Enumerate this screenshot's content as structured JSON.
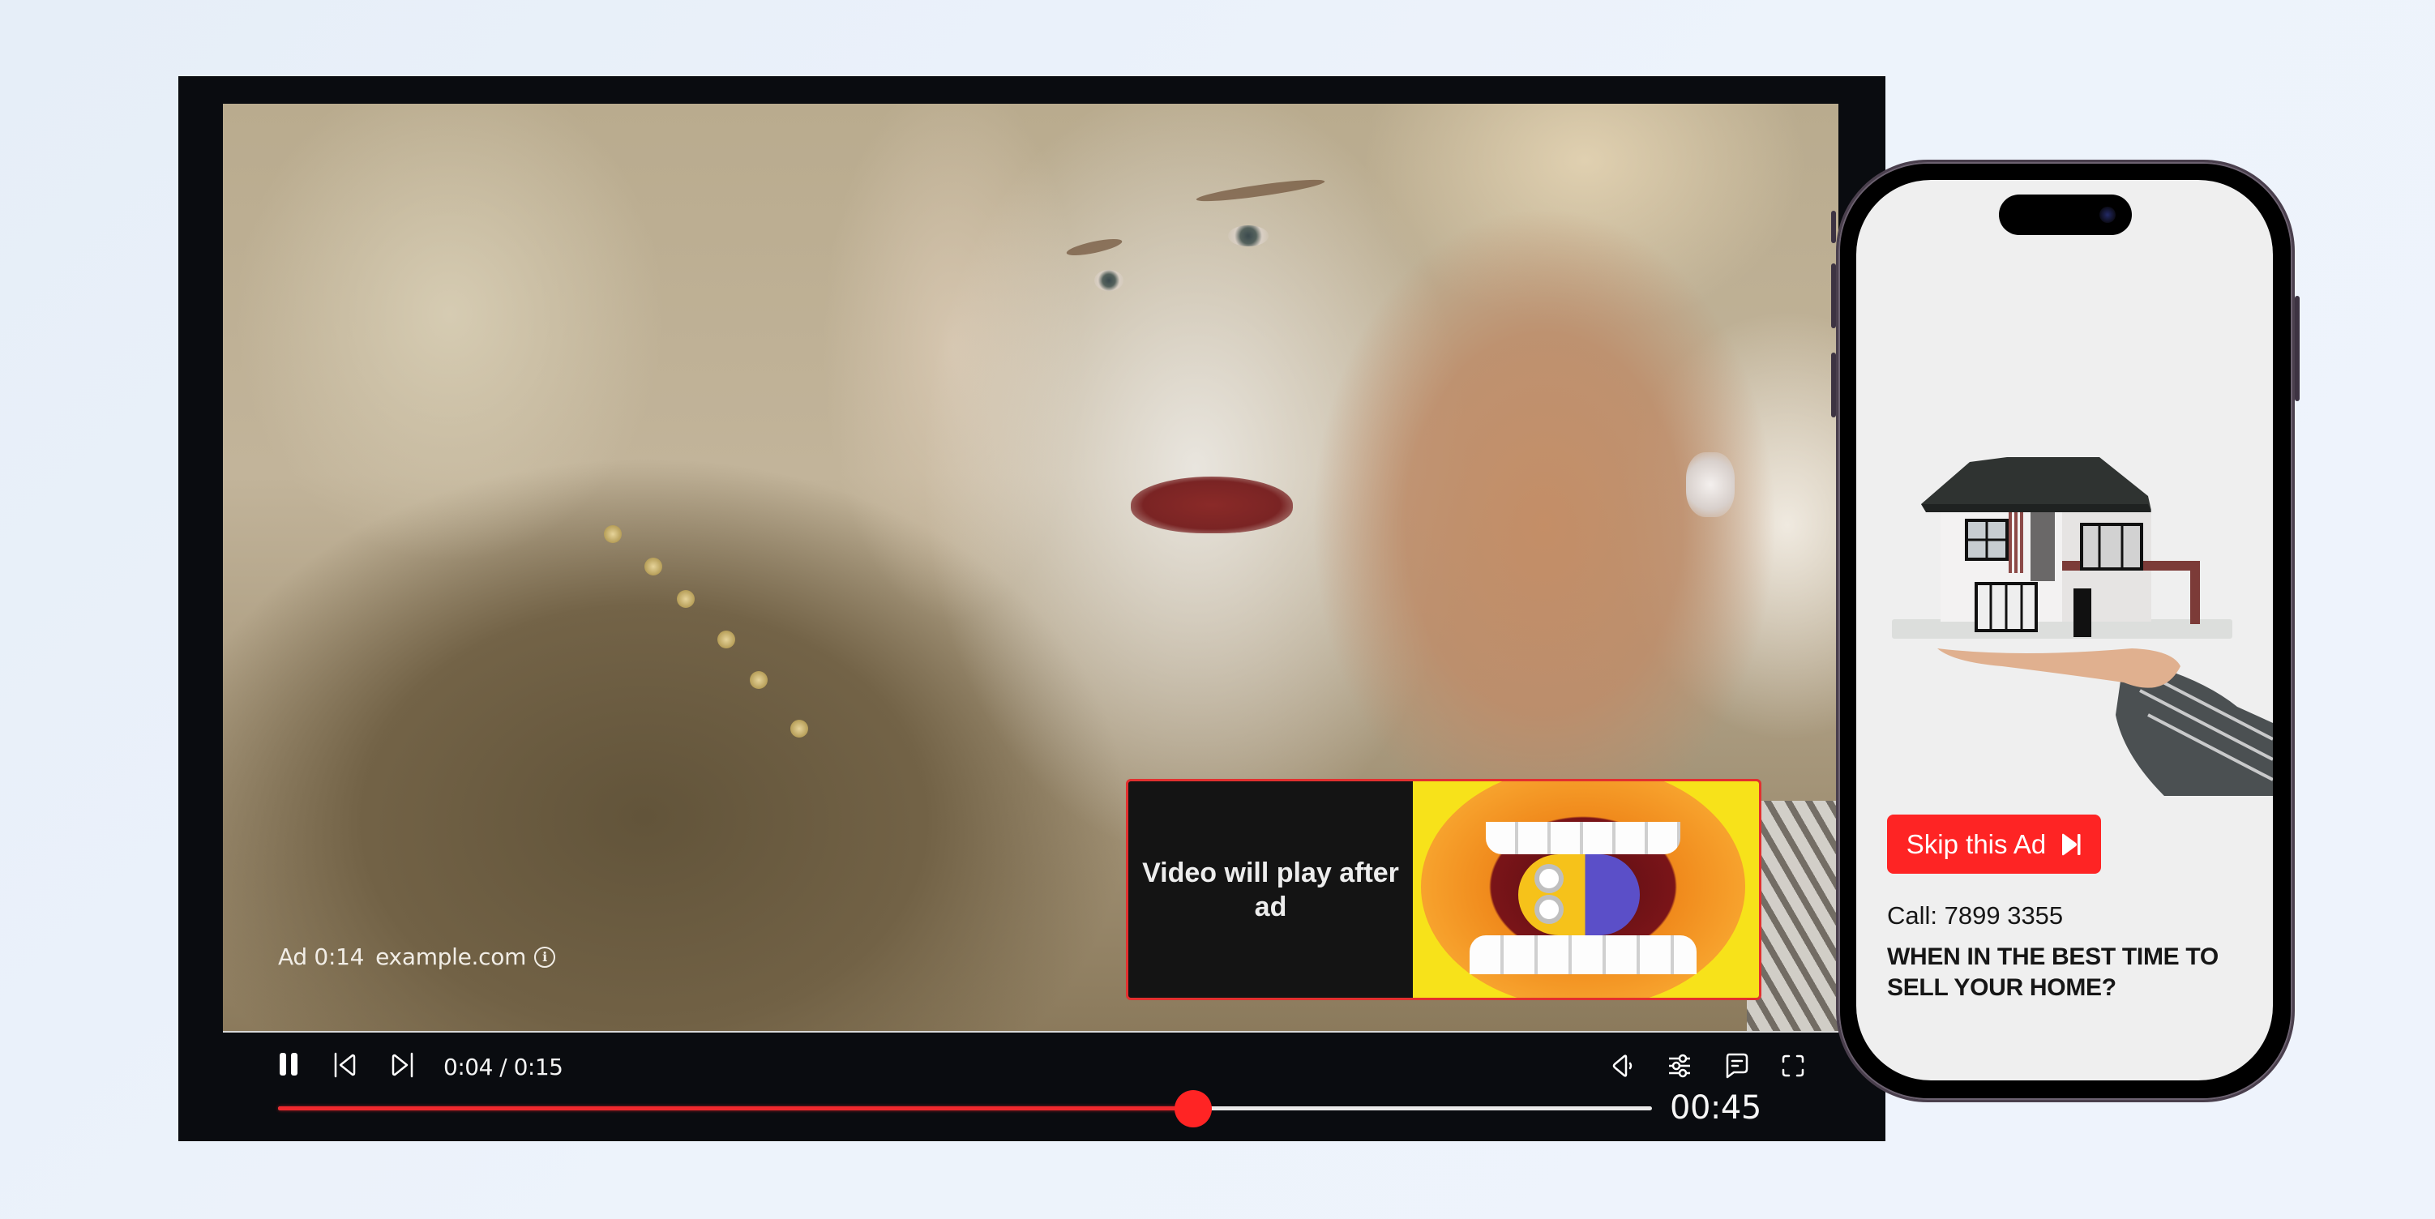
{
  "player": {
    "ad_badge": {
      "ad_countdown": "Ad 0:14",
      "advertiser_domain": "example.com",
      "info_icon": "info-circle-icon"
    },
    "ad_overlay": {
      "message": "Video will play after ad",
      "thumbnail": "minion-in-mouth-thumbnail"
    },
    "controls": {
      "pause_icon": "pause-icon",
      "previous_icon": "skip-previous-icon",
      "next_icon": "skip-next-icon",
      "time_display": "0:04 / 0:15",
      "volume_icon": "volume-icon",
      "settings_icon": "sliders-icon",
      "captions_icon": "chat-bubble-icon",
      "fullscreen_icon": "fullscreen-icon",
      "duration": "00:45",
      "progress": 0.666,
      "accent_color": "#f0282d"
    }
  },
  "phone_ad": {
    "image": "house-model-on-hand",
    "skip_button": {
      "label": "Skip this Ad",
      "icon": "skip-next-filled-icon",
      "color": "#fe2424"
    },
    "call_text": "Call: 7899 3355",
    "headline": "WHEN IN THE BEST TIME TO SELL YOUR HOME?"
  }
}
